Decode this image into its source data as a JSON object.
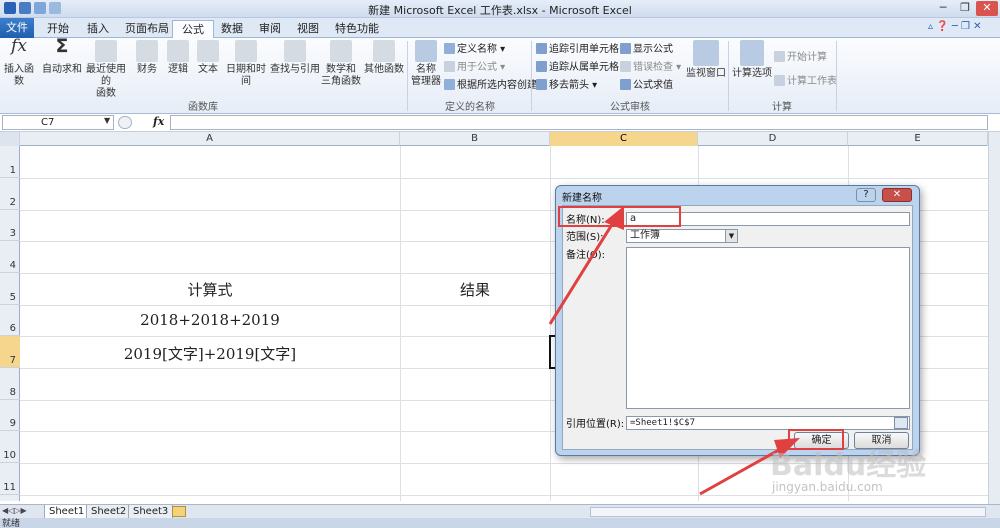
{
  "window": {
    "title": "新建 Microsoft Excel 工作表.xlsx - Microsoft Excel",
    "controls": {
      "minimize": "─",
      "restore": "❐",
      "close": "✕"
    }
  },
  "tabs": [
    {
      "label": "文件"
    },
    {
      "label": "开始"
    },
    {
      "label": "插入"
    },
    {
      "label": "页面布局"
    },
    {
      "label": "公式"
    },
    {
      "label": "数据"
    },
    {
      "label": "审阅"
    },
    {
      "label": "视图"
    },
    {
      "label": "特色功能"
    }
  ],
  "ribbon": {
    "function_library": {
      "label": "函数库",
      "insert_function": "插入函数",
      "autosum": "自动求和",
      "recent_line1": "最近使用的",
      "recent_line2": "函数",
      "finance": "财务",
      "logic": "逻辑",
      "text": "文本",
      "datetime": "日期和时间",
      "lookup": "查找与引用",
      "math_line1": "数学和",
      "math_line2": "三角函数",
      "other": "其他函数"
    },
    "defined_names": {
      "label": "定义的名称",
      "name_manager_line1": "名称",
      "name_manager_line2": "管理器",
      "define_name": "定义名称",
      "use_in_formula": "用于公式",
      "create_from_selection": "根据所选内容创建"
    },
    "formula_auditing": {
      "label": "公式审核",
      "trace_precedents": "追踪引用单元格",
      "trace_dependents": "追踪从属单元格",
      "remove_arrows": "移去箭头",
      "show_formulas": "显示公式",
      "error_checking": "错误检查",
      "evaluate_formula": "公式求值",
      "watch_window": "监视窗口"
    },
    "calculation": {
      "label": "计算",
      "calc_options": "计算选项",
      "calc_now": "开始计算",
      "calc_sheet": "计算工作表"
    }
  },
  "formula_bar": {
    "name_box": "C7",
    "fx": "fx",
    "value": ""
  },
  "grid": {
    "columns": [
      "A",
      "B",
      "C",
      "D",
      "E"
    ],
    "rows": [
      "1",
      "2",
      "3",
      "4",
      "5",
      "6",
      "7",
      "8",
      "9",
      "10",
      "11"
    ],
    "cells": {
      "A5": "计算式",
      "B5": "结果",
      "A6": "2018+2018+2019",
      "A7": "2019[文字]+2019[文字]"
    },
    "selected_cell": "C7"
  },
  "sheets": [
    "Sheet1",
    "Sheet2",
    "Sheet3"
  ],
  "dialog": {
    "title": "新建名称",
    "help": "?",
    "close": "✕",
    "name_label": "名称(N):",
    "name_value": "a",
    "scope_label": "范围(S):",
    "scope_value": "工作簿",
    "comment_label": "备注(O):",
    "comment_value": "",
    "refers_label": "引用位置(R):",
    "refers_value": "=Sheet1!$C$7",
    "ok": "确定",
    "cancel": "取消"
  },
  "status": {
    "ready": "就绪"
  },
  "watermark": {
    "brand": "Baidu经验",
    "url": "jingyan.baidu.com"
  },
  "colors": {
    "accent": "#2a62b4",
    "selection": "#f6d68c",
    "annotation": "#e04040"
  }
}
